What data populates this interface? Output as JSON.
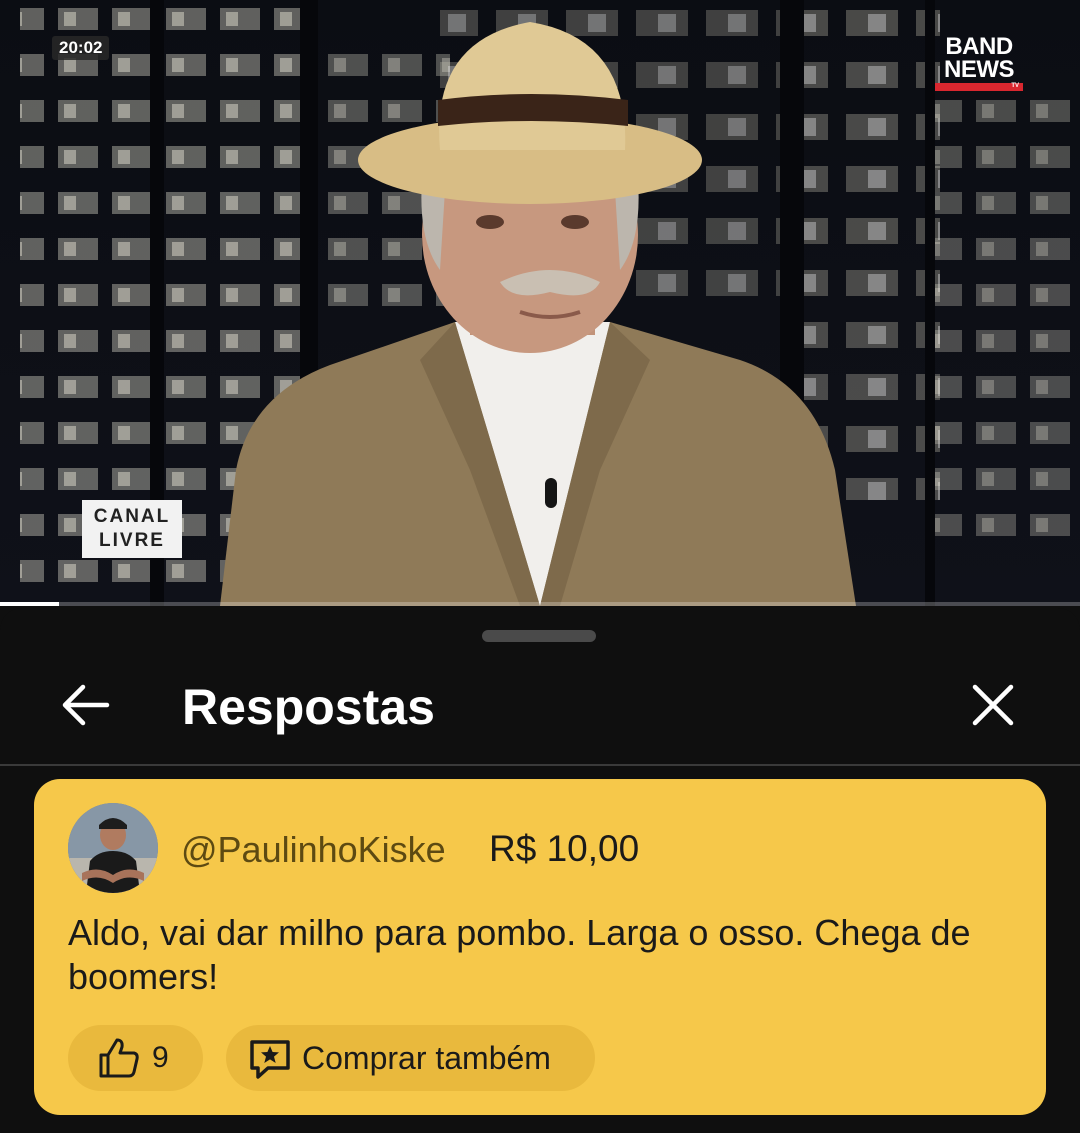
{
  "video": {
    "timestamp": "20:02",
    "channel_logo_line1": "BAND",
    "channel_logo_line2": "NEWS",
    "channel_logo_tv": "TV",
    "program_line1": "CANAL",
    "program_line2": "LIVRE",
    "progress_fraction": 0.055,
    "progress_color": "#ffffff"
  },
  "sheet": {
    "title": "Respostas",
    "back_icon": "arrow-left-icon",
    "close_icon": "close-icon"
  },
  "super_chat": {
    "author": "@PaulinhoKiske",
    "amount": "R$ 10,00",
    "message": "Aldo, vai dar milho para pombo. Larga o osso. Chega de boomers!",
    "like_icon": "thumbs-up-icon",
    "like_count": "9",
    "buy_icon": "super-chat-star-icon",
    "buy_label": "Comprar também",
    "background_color": "#f6c84a",
    "pill_color": "#e9b93d"
  }
}
